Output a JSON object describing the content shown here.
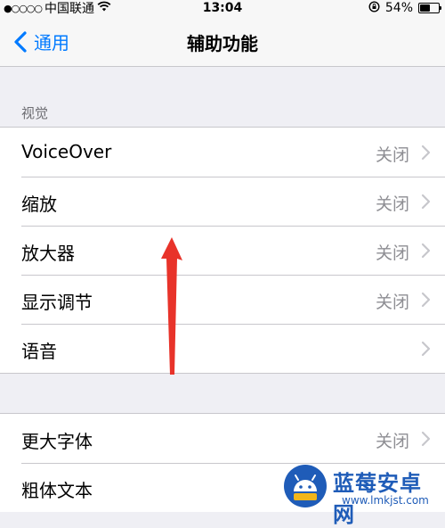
{
  "status_bar": {
    "signal_dots": "●○○○○",
    "carrier": "中国联通",
    "wifi_icon": "wifi-icon",
    "time": "13:04",
    "battery_percent": "54%",
    "battery_level": 0.54
  },
  "nav": {
    "back_label": "通用",
    "title": "辅助功能"
  },
  "section_vision": {
    "header": "视觉",
    "rows": [
      {
        "label": "VoiceOver",
        "value": "关闭"
      },
      {
        "label": "缩放",
        "value": "关闭"
      },
      {
        "label": "放大器",
        "value": "关闭"
      },
      {
        "label": "显示调节",
        "value": "关闭"
      },
      {
        "label": "语音",
        "value": ""
      }
    ]
  },
  "section_text": {
    "rows": [
      {
        "label": "更大字体",
        "value": "关闭"
      },
      {
        "label": "粗体文本",
        "value": ""
      }
    ]
  },
  "annotation": {
    "color": "#e8332a"
  },
  "watermark": {
    "title": "蓝莓安卓网",
    "url": "www.lmkjst.com"
  },
  "colors": {
    "accent": "#007aff",
    "background": "#efeff4",
    "secondary_text": "#8e8e93"
  }
}
